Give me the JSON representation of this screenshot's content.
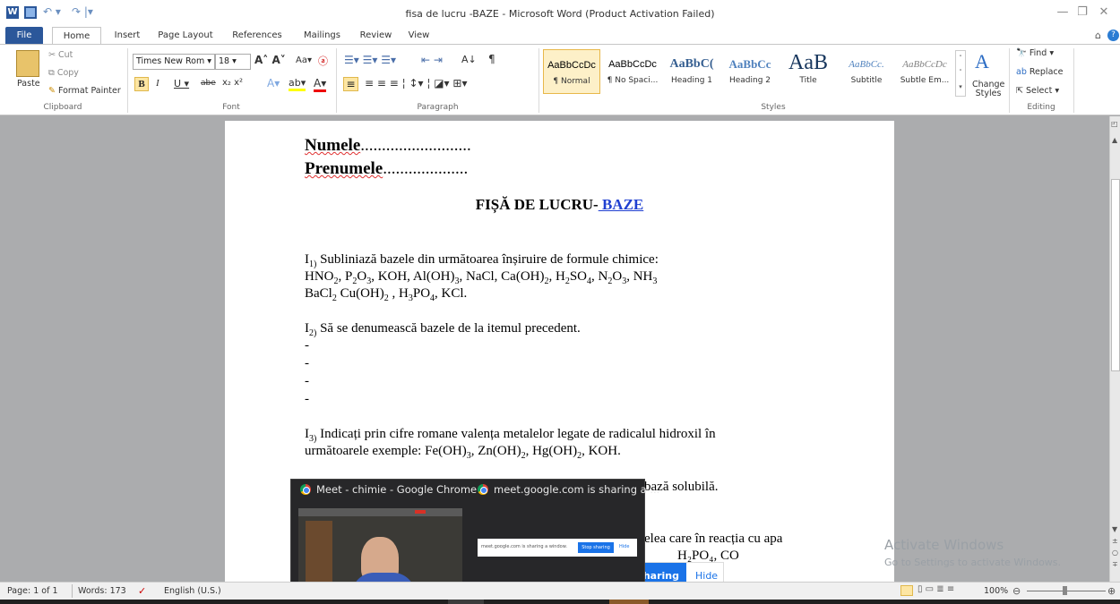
{
  "window": {
    "title": "fisa de lucru -BAZE  -  Microsoft Word (Product Activation Failed)"
  },
  "tabs": [
    "File",
    "Home",
    "Insert",
    "Page Layout",
    "References",
    "Mailings",
    "Review",
    "View"
  ],
  "clipboard": {
    "paste": "Paste",
    "cut": "Cut",
    "copy": "Copy",
    "format_painter": "Format Painter",
    "label": "Clipboard"
  },
  "font": {
    "name": "Times New Rom",
    "size": "18",
    "label": "Font"
  },
  "paragraph": {
    "label": "Paragraph"
  },
  "styles": {
    "label": "Styles",
    "items": [
      {
        "preview": "AaBbCcDc",
        "name": "¶ Normal"
      },
      {
        "preview": "AaBbCcDc",
        "name": "¶ No Spaci..."
      },
      {
        "preview": "AaBbC(",
        "name": "Heading 1"
      },
      {
        "preview": "AaBbCc",
        "name": "Heading 2"
      },
      {
        "preview": "AaB",
        "name": "Title"
      },
      {
        "preview": "AaBbCc.",
        "name": "Subtitle"
      },
      {
        "preview": "AaBbCcDc",
        "name": "Subtle Em..."
      }
    ],
    "change": "Change Styles"
  },
  "editing": {
    "find": "Find",
    "replace": "Replace",
    "select": "Select",
    "label": "Editing"
  },
  "document": {
    "numele": "Numele",
    "numele_dots": "..........................",
    "prenume": "Prenumele",
    "prenume_dots": "....................",
    "heading": "FIȘĂ DE LUCRU-",
    "heading_link": " BAZE",
    "i1_label": "I",
    "i1_sub": "1)",
    "i1_text": " Subliniază bazele din următoarea înșiruire de formule chimice:",
    "i2_label": "I",
    "i2_sub": "2)",
    "i2_text": " Să se denumească bazele de la itemul precedent.",
    "dash": "-",
    "i3_label": "I",
    "i3_sub": "3)",
    "i3_text": " Indicați prin cifre romane valența metalelor legate de radicalul hidroxil în",
    "i3_line2": "următoarele exemple: Fe(OH)",
    "partial_1": "bază solubilă.",
    "partial_2": "elea care în reacția cu apa",
    "partial_3": "H₂PO₄, CO"
  },
  "popup": {
    "tab1": "Meet - chimie - Google Chrome",
    "tab2": "meet.google.com is sharing a ...",
    "mini_text": "meet.google.com is sharing a window.",
    "mini_stop": "Stop sharing",
    "mini_hide": "Hide"
  },
  "sharebar": {
    "sharing": "haring",
    "hide": "Hide"
  },
  "status": {
    "page": "Page: 1 of 1",
    "words": "Words: 173",
    "lang": "English (U.S.)",
    "zoom": "100%"
  },
  "watermark": {
    "line1": "Activate Windows",
    "line2": "Go to Settings to activate Windows."
  },
  "colors": {
    "accent": "#2b579a",
    "link": "#1f3fd1",
    "share_blue": "#1a73e8"
  }
}
